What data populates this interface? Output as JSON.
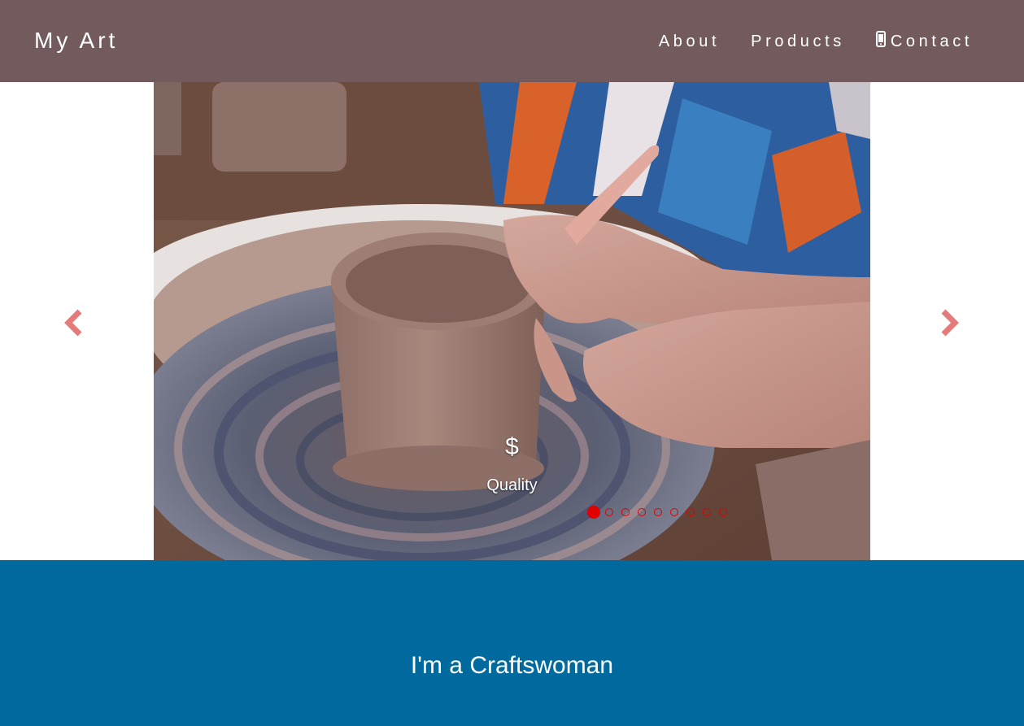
{
  "nav": {
    "brand": "My Art",
    "links": [
      {
        "label": "About"
      },
      {
        "label": "Products"
      },
      {
        "label": "Contact",
        "icon": "mobile-phone-icon"
      }
    ]
  },
  "carousel": {
    "slide": {
      "image": "pottery-wheel-photo",
      "icon_text": "$",
      "caption": "Quality"
    },
    "indicator_count": 9,
    "active_index": 0,
    "prev_icon": "chevron-left-icon",
    "next_icon": "chevron-right-icon"
  },
  "hero": {
    "title": "I'm a Craftswoman"
  },
  "colors": {
    "navbar": "#735b5d",
    "hero": "#006a9e",
    "arrow": "#e47a7a",
    "indicator": "#e00000"
  }
}
